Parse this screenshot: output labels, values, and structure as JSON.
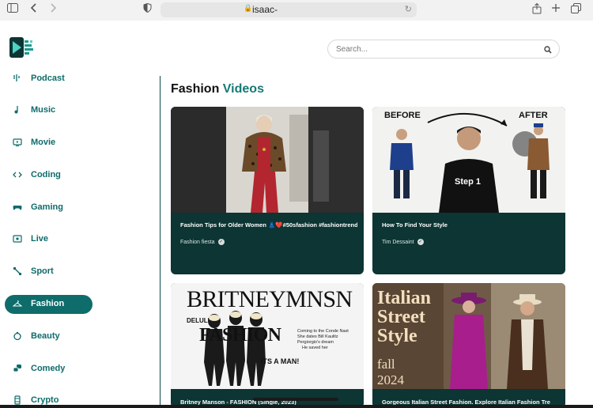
{
  "browser": {
    "url": "isaac-",
    "icons": [
      "sidebar-toggle-icon",
      "back-icon",
      "forward-icon",
      "privacy-shield-icon",
      "lock-icon",
      "reload-icon",
      "share-icon",
      "new-tab-icon",
      "tabs-overview-icon"
    ]
  },
  "search": {
    "placeholder": "Search..."
  },
  "sidebar": {
    "items": [
      {
        "label": "Podcast",
        "icon": "podcast-icon"
      },
      {
        "label": "Music",
        "icon": "music-note-icon"
      },
      {
        "label": "Movie",
        "icon": "movie-icon"
      },
      {
        "label": "Coding",
        "icon": "code-icon"
      },
      {
        "label": "Gaming",
        "icon": "gamepad-icon"
      },
      {
        "label": "Live",
        "icon": "live-icon"
      },
      {
        "label": "Sport",
        "icon": "sport-icon"
      },
      {
        "label": "Fashion",
        "icon": "hanger-icon",
        "active": true
      },
      {
        "label": "Beauty",
        "icon": "beauty-icon"
      },
      {
        "label": "Comedy",
        "icon": "comedy-icon"
      },
      {
        "label": "Crypto",
        "icon": "crypto-icon"
      }
    ]
  },
  "main": {
    "title_prefix": "Fashion",
    "title_accent": "Videos",
    "videos": [
      {
        "title": "Fashion Tips for Older Women 👗❤️#50sfashion #fashiontrends",
        "author": "Fashion fiesta",
        "verified": true
      },
      {
        "title": "How To Find Your Style",
        "author": "Tim Dessaint",
        "verified": true
      },
      {
        "title": "Britney Manson - FASHION (Single, 2023)",
        "author": ""
      },
      {
        "title": "Gorgeous Italian Street Fashion. Explore Italian Fashion Tre",
        "author": ""
      }
    ],
    "thumb_text": {
      "before": "BEFORE",
      "after": "AFTER",
      "step": "Step 1",
      "magazine_masthead": "BRITNEYMNSN",
      "magazine_delulu": "DELULU",
      "magazine_fashion": "FASHION",
      "magazine_itsaman": "ITS A MAN!",
      "magazine_blurb": "Coming to the Conde Nast She dates Bill Kaulitz Pergiorgio's dream He saved her",
      "italian_line1": "Italian",
      "italian_line2": "Street",
      "italian_line3": "Style",
      "italian_year1": "fall",
      "italian_year2": "2024"
    }
  },
  "colors": {
    "accent": "#0e6d6b",
    "card_bg": "#0c3533",
    "title_accent": "#157a73"
  }
}
